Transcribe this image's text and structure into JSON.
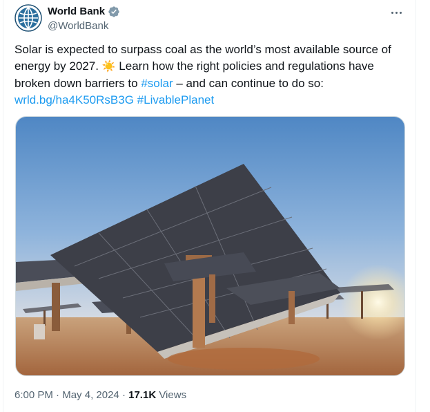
{
  "author": {
    "display_name": "World Bank",
    "handle": "@WorldBank",
    "avatar_icon": "world-bank-globe-logo",
    "verified_icon": "gray-verified-badge",
    "verified_color": "#829aab"
  },
  "tweet": {
    "text_part1": "Solar is expected to surpass coal as the world’s most available source of energy by 2027. ",
    "emoji": "☀️",
    "text_part2": " Learn how the right policies and regulations have broken down barriers to ",
    "hashtag_solar": "#solar",
    "text_part3": " – and can continue to do so:",
    "link": "wrld.bg/ha4K50RsB3G",
    "hashtag_livable": "#LivablePlanet"
  },
  "media": {
    "alt": "Solar panel arrays in a desert at sunset"
  },
  "meta": {
    "time": "6:00 PM",
    "separator": " · ",
    "date": "May 4, 2024",
    "views_count": "17.1K",
    "views_label": " Views"
  },
  "colors": {
    "link": "#1d9bf0",
    "muted": "#536471",
    "text": "#0f1419"
  }
}
